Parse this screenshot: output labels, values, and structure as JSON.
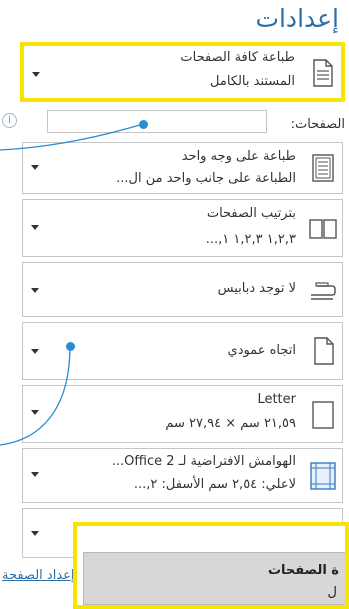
{
  "title": "إعدادات",
  "rows": {
    "print_all": {
      "line1": "طباعة كافة الصفحات",
      "line2": "المستند بالكامل"
    },
    "pages": {
      "label": "الصفحات:",
      "value": ""
    },
    "one_side": {
      "line1": "طباعة على وجه واحد",
      "line2": "الطباعة على جانب واحد من ال..."
    },
    "collate": {
      "line1": "بترتيب الصفحات",
      "line2": "١,٢,٣    ١,٢,٣    ١,..."
    },
    "staple": {
      "line1": "لا توجد دبابيس"
    },
    "orientation": {
      "line1": "اتجاه عمودي"
    },
    "paper": {
      "line1": "Letter",
      "line2": "٢١,٥٩ سم × ٢٧,٩٤ سم"
    },
    "margins": {
      "line1": "الهوامش الافتراضية لـ Office 2...",
      "line2": "لاعلي: ٢,٥٤ سم الأسفل: ٢,..."
    }
  },
  "page_setup_link": "إعداد الصفحة",
  "overlay": {
    "line1": "ة الصفحات",
    "line2": "ل"
  },
  "colors": {
    "accent": "#2e6fa7",
    "highlight": "#f7e400",
    "callout": "#2a8dd4"
  }
}
